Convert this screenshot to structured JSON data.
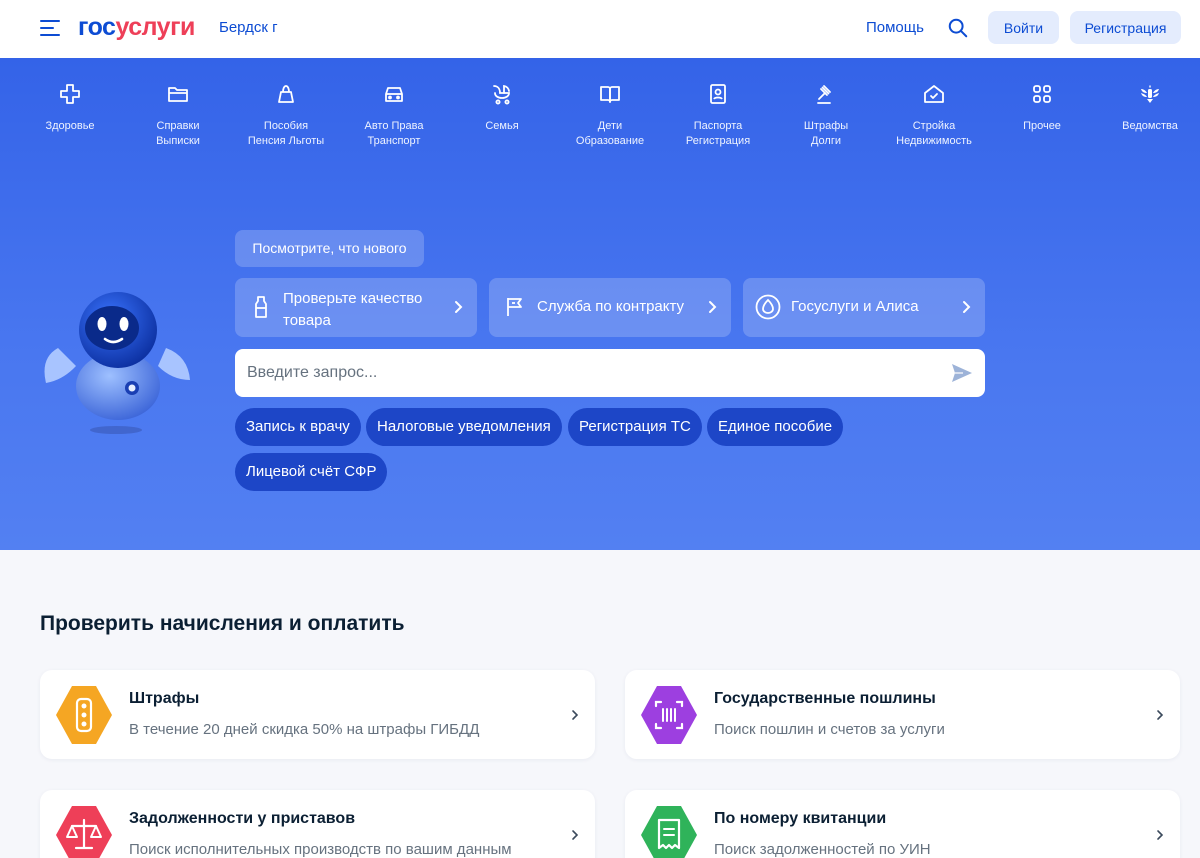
{
  "header": {
    "logo_part1": "гос",
    "logo_part2": "услуги",
    "city": "Бердск г",
    "help": "Помощь",
    "login": "Войти",
    "register": "Регистрация"
  },
  "categories": [
    {
      "line1": "Здоровье",
      "line2": "",
      "icon": "health-cross-icon"
    },
    {
      "line1": "Справки",
      "line2": "Выписки",
      "icon": "folder-icon"
    },
    {
      "line1": "Пособия",
      "line2": "Пенсия Льготы",
      "icon": "wallet-icon"
    },
    {
      "line1": "Авто Права",
      "line2": "Транспорт",
      "icon": "car-icon"
    },
    {
      "line1": "Семья",
      "line2": "",
      "icon": "stroller-icon"
    },
    {
      "line1": "Дети",
      "line2": "Образование",
      "icon": "book-icon"
    },
    {
      "line1": "Паспорта",
      "line2": "Регистрация",
      "icon": "passport-icon"
    },
    {
      "line1": "Штрафы",
      "line2": "Долги",
      "icon": "gavel-icon"
    },
    {
      "line1": "Стройка",
      "line2": "Недвижимость",
      "icon": "house-icon"
    },
    {
      "line1": "Прочее",
      "line2": "",
      "icon": "grid-icon"
    },
    {
      "line1": "Ведомства",
      "line2": "",
      "icon": "eagle-icon"
    }
  ],
  "hero": {
    "news": "Посмотрите, что нового",
    "promos": [
      {
        "label": "Проверьте качество товара",
        "icon": "bottle-icon"
      },
      {
        "label": "Служба по контракту",
        "icon": "flag-icon"
      },
      {
        "label": "Госуслуги и Алиса",
        "icon": "alice-icon"
      }
    ],
    "search_placeholder": "Введите запрос...",
    "chips": [
      "Запись к врачу",
      "Налоговые уведомления",
      "Регистрация ТС",
      "Единое пособие",
      "Лицевой счёт СФР"
    ]
  },
  "payments": {
    "title": "Проверить начисления и оплатить",
    "cards": [
      {
        "title": "Штрафы",
        "subtitle": "В течение 20 дней скидка 50% на штрафы ГИБДД",
        "icon": "traffic-light-icon",
        "color": "#f5a623"
      },
      {
        "title": "Государственные пошлины",
        "subtitle": "Поиск пошлин и счетов за услуги",
        "icon": "barcode-icon",
        "color": "#9d3fe0"
      },
      {
        "title": "Задолженности у приставов",
        "subtitle": "Поиск исполнительных производств по вашим данным",
        "icon": "scales-icon",
        "color": "#ee3f58"
      },
      {
        "title": "По номеру квитанции",
        "subtitle": "Поиск задолженностей по УИН",
        "icon": "receipt-icon",
        "color": "#2fb35a"
      }
    ]
  },
  "colors": {
    "brand": "#0d4cd3",
    "accent": "#ee3f58",
    "hero": "#3463e8",
    "chip": "#1d46c7"
  }
}
